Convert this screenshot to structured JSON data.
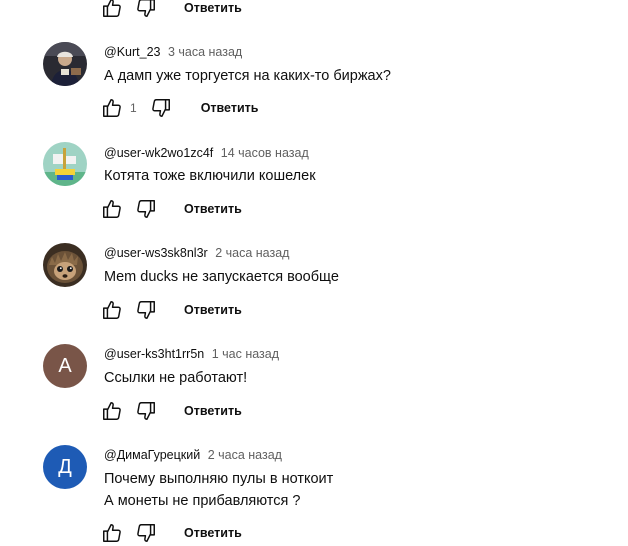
{
  "reply_label": "Ответить",
  "comments": [
    {
      "author": "",
      "time": "",
      "text": [],
      "likes": ""
    },
    {
      "author": "@Kurt_23",
      "time": "3 часа назад",
      "text": [
        "А дамп уже торгуется на каких-то биржах?"
      ],
      "likes": "1",
      "avatar": {
        "type": "photo",
        "icon": "person-photo-avatar"
      }
    },
    {
      "author": "@user-wk2wo1zc4f",
      "time": "14 часов назад",
      "text": [
        "Котята тоже включили кошелек"
      ],
      "likes": "",
      "avatar": {
        "type": "pixel",
        "icon": "pixel-boat-avatar"
      }
    },
    {
      "author": "@user-ws3sk8nl3r",
      "time": "2 часа назад",
      "text": [
        "Mem ducks не запускается вообще"
      ],
      "likes": "",
      "avatar": {
        "type": "photo",
        "icon": "hedgehog-avatar"
      }
    },
    {
      "author": "@user-ks3ht1rr5n",
      "time": "1 час назад",
      "text": [
        "Ссылки не работают!"
      ],
      "likes": "",
      "avatar": {
        "type": "letter",
        "letter": "А",
        "color": "#795548"
      }
    },
    {
      "author": "@ДимаГурецкий",
      "time": "2 часа назад",
      "text": [
        "Почему выполняю пулы в ноткоит",
        "А монеты не прибавляются ?"
      ],
      "likes": "",
      "avatar": {
        "type": "letter",
        "letter": "Д",
        "color": "#1e5bb5"
      }
    }
  ]
}
